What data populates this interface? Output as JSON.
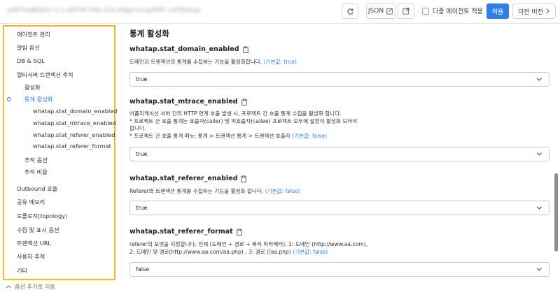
{
  "topbar": {
    "agent_id": "yGlFhsaBGbVr-3-1-aRFHP-S6b-11b-9dgd-a1rgsB9F-u1f3bdvgs",
    "json_label": "JSON",
    "multi_apply_label": "다중 에이전트 적용",
    "apply_label": "적용",
    "prev_version_label": "이전 버전",
    "icons": [
      "refresh-icon",
      "edit-icon",
      "export-icon",
      "chevron-right-icon"
    ],
    "accent_color": "#2f7fe8"
  },
  "sidebar": {
    "highlight_color": "#f3b91b",
    "items": [
      {
        "label": "에이전트 관리"
      },
      {
        "label": "알림 옵션"
      },
      {
        "label": "DB & SQL"
      },
      {
        "label": "멀티서버 트랜잭션 추적"
      },
      {
        "label": "활성화"
      },
      {
        "label": "통계 활성화"
      },
      {
        "label": "whatap.stat_domain_enabled"
      },
      {
        "label": "whatap.stat_mtrace_enabled"
      },
      {
        "label": "whatap.stat_referer_enabled"
      },
      {
        "label": "whatap.stat_referer_format"
      },
      {
        "label": "추적 옵션"
      },
      {
        "label": "추적 비율"
      },
      {
        "label": "Outbound 호출"
      },
      {
        "label": "공유 메모리"
      },
      {
        "label": "토폴로지(topology)"
      },
      {
        "label": "수집 및 표시 옵션"
      },
      {
        "label": "트랜잭션 URL"
      },
      {
        "label": "사용자 추적"
      },
      {
        "label": "기타"
      }
    ],
    "move_option_label": "옵션 추가로 이동"
  },
  "main": {
    "title": "통계 활성화",
    "sections": [
      {
        "title": "whatap.stat_domain_enabled",
        "desc_lines": [
          "도메인과 트랜잭션의 통계를 수집하는 기능을 활성화합니다."
        ],
        "default": "(기본값: true)",
        "value": "true"
      },
      {
        "title": "whatap.stat_mtrace_enabled",
        "desc_lines": [
          "어플리케이션 서버 간의 HTTP 연계 호출 발생 시, 프로젝트 간 호출 통계 수집을 활성화 합니다.",
          "* 프로젝트 간 호출 통계는 호출자(caller) 및 피호출자(callee) 프로젝트 모두에 설정이 활성화 되어야",
          "합니다.",
          "* 프로젝트 간 호출 통계 메뉴: 통계 > 트랜잭션 통계 > 트랜잭션 호출자"
        ],
        "default": "(기본값: false)",
        "value": "true"
      },
      {
        "title": "whatap.stat_referer_enabled",
        "desc_lines": [
          "Referer와 트랜잭션 통계를 수집하는 기능을 활성화 합니다."
        ],
        "default": "(기본값: false)",
        "value": "true"
      },
      {
        "title": "whatap.stat_referer_format",
        "desc_lines": [
          "referer의 포맷을 지정합니다. 전체 (도메인 + 경로 + 쿼리 파라메터), 1: 도메인 (http://www.aa.com),",
          "2: 도메인 및 경로(http://www.aa.com/aa.php) , 3: 경로 (/aa.php)"
        ],
        "default": "(기본값: false)",
        "value": "false"
      }
    ]
  }
}
